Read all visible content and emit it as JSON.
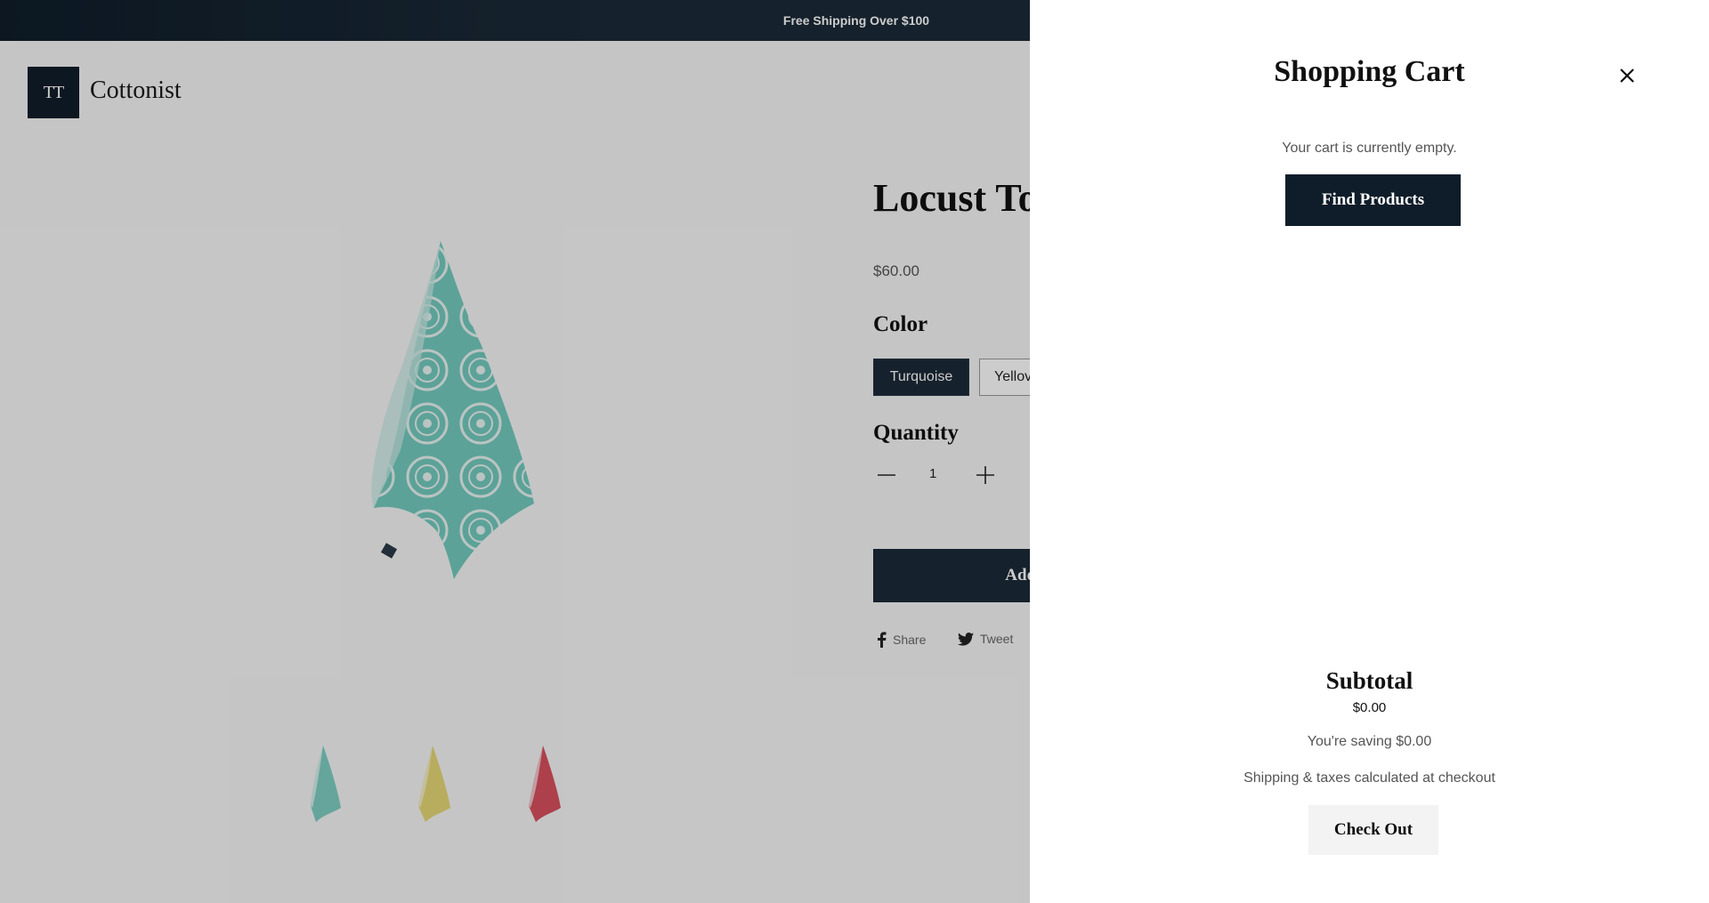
{
  "announcement": {
    "text": "Free Shipping Over $100"
  },
  "header": {
    "logo_mark": "TT",
    "brand": "Cottonist"
  },
  "product": {
    "title": "Locust To",
    "price": "$60.00",
    "color_label": "Color",
    "colors": [
      {
        "label": "Turquoise",
        "selected": true
      },
      {
        "label": "Yellov",
        "selected": false
      }
    ],
    "quantity_label": "Quantity",
    "quantity": "1",
    "add_to_cart": "Add to Ca",
    "share": {
      "facebook": "Share",
      "twitter": "Tweet"
    },
    "thumbnails": [
      {
        "color": "turquoise"
      },
      {
        "color": "yellow"
      },
      {
        "color": "red"
      }
    ]
  },
  "cart": {
    "title": "Shopping Cart",
    "empty_message": "Your cart is currently empty.",
    "find_products": "Find Products",
    "subtotal_label": "Subtotal",
    "subtotal_value": "$0.00",
    "saving": "You're saving $0.00",
    "shipping_note": "Shipping & taxes calculated at checkout",
    "checkout": "Check Out"
  },
  "colors": {
    "dark_navy": "#0f1d2a",
    "button_navy": "#1b2a38",
    "turquoise": "#6fcabd",
    "yellow": "#e3d36e",
    "red": "#d8505e"
  }
}
